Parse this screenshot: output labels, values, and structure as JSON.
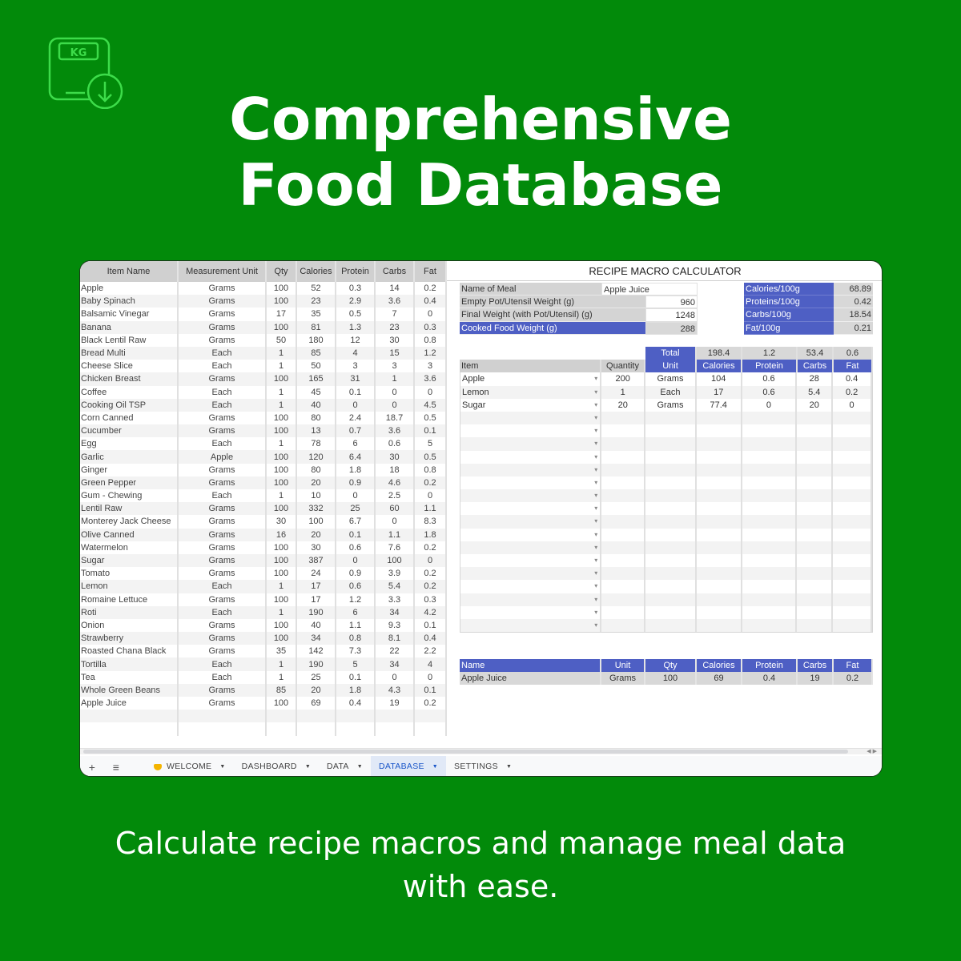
{
  "headline": {
    "line1": "Comprehensive",
    "line2": "Food Database"
  },
  "subline": {
    "line1": "Calculate recipe macros and manage meal data",
    "line2": "with ease."
  },
  "logo": {
    "icon": "weight-scale-download-icon",
    "label": "KG",
    "color": "#3ddc4a"
  },
  "colors": {
    "background": "#028a0a",
    "accent_blue": "#4e5fc4",
    "header_grey": "#d0d0d0"
  },
  "database": {
    "columns": [
      "Item Name",
      "Measurement Unit",
      "Qty",
      "Calories",
      "Protein",
      "Carbs",
      "Fat"
    ],
    "rows": [
      [
        "Apple",
        "Grams",
        "100",
        "52",
        "0.3",
        "14",
        "0.2"
      ],
      [
        "Baby Spinach",
        "Grams",
        "100",
        "23",
        "2.9",
        "3.6",
        "0.4"
      ],
      [
        "Balsamic Vinegar",
        "Grams",
        "17",
        "35",
        "0.5",
        "7",
        "0"
      ],
      [
        "Banana",
        "Grams",
        "100",
        "81",
        "1.3",
        "23",
        "0.3"
      ],
      [
        "Black Lentil Raw",
        "Grams",
        "50",
        "180",
        "12",
        "30",
        "0.8"
      ],
      [
        "Bread Multi",
        "Each",
        "1",
        "85",
        "4",
        "15",
        "1.2"
      ],
      [
        "Cheese Slice",
        "Each",
        "1",
        "50",
        "3",
        "3",
        "3"
      ],
      [
        "Chicken Breast",
        "Grams",
        "100",
        "165",
        "31",
        "1",
        "3.6"
      ],
      [
        "Coffee",
        "Each",
        "1",
        "45",
        "0.1",
        "0",
        "0"
      ],
      [
        "Cooking Oil TSP",
        "Each",
        "1",
        "40",
        "0",
        "0",
        "4.5"
      ],
      [
        "Corn Canned",
        "Grams",
        "100",
        "80",
        "2.4",
        "18.7",
        "0.5"
      ],
      [
        "Cucumber",
        "Grams",
        "100",
        "13",
        "0.7",
        "3.6",
        "0.1"
      ],
      [
        "Egg",
        "Each",
        "1",
        "78",
        "6",
        "0.6",
        "5"
      ],
      [
        "Garlic",
        "Apple",
        "100",
        "120",
        "6.4",
        "30",
        "0.5"
      ],
      [
        "Ginger",
        "Grams",
        "100",
        "80",
        "1.8",
        "18",
        "0.8"
      ],
      [
        "Green Pepper",
        "Grams",
        "100",
        "20",
        "0.9",
        "4.6",
        "0.2"
      ],
      [
        "Gum - Chewing",
        "Each",
        "1",
        "10",
        "0",
        "2.5",
        "0"
      ],
      [
        "Lentil Raw",
        "Grams",
        "100",
        "332",
        "25",
        "60",
        "1.1"
      ],
      [
        "Monterey Jack Cheese",
        "Grams",
        "30",
        "100",
        "6.7",
        "0",
        "8.3"
      ],
      [
        "Olive Canned",
        "Grams",
        "16",
        "20",
        "0.1",
        "1.1",
        "1.8"
      ],
      [
        "Watermelon",
        "Grams",
        "100",
        "30",
        "0.6",
        "7.6",
        "0.2"
      ],
      [
        "Sugar",
        "Grams",
        "100",
        "387",
        "0",
        "100",
        "0"
      ],
      [
        "Tomato",
        "Grams",
        "100",
        "24",
        "0.9",
        "3.9",
        "0.2"
      ],
      [
        "Lemon",
        "Each",
        "1",
        "17",
        "0.6",
        "5.4",
        "0.2"
      ],
      [
        "Romaine Lettuce",
        "Grams",
        "100",
        "17",
        "1.2",
        "3.3",
        "0.3"
      ],
      [
        "Roti",
        "Each",
        "1",
        "190",
        "6",
        "34",
        "4.2"
      ],
      [
        "Onion",
        "Grams",
        "100",
        "40",
        "1.1",
        "9.3",
        "0.1"
      ],
      [
        "Strawberry",
        "Grams",
        "100",
        "34",
        "0.8",
        "8.1",
        "0.4"
      ],
      [
        "Roasted Chana Black",
        "Grams",
        "35",
        "142",
        "7.3",
        "22",
        "2.2"
      ],
      [
        "Tortilla",
        "Each",
        "1",
        "190",
        "5",
        "34",
        "4"
      ],
      [
        "Tea",
        "Each",
        "1",
        "25",
        "0.1",
        "0",
        "0"
      ],
      [
        "Whole Green Beans",
        "Grams",
        "85",
        "20",
        "1.8",
        "4.3",
        "0.1"
      ],
      [
        "Apple Juice",
        "Grams",
        "100",
        "69",
        "0.4",
        "19",
        "0.2"
      ],
      [
        "",
        "",
        "",
        "",
        "",
        "",
        ""
      ],
      [
        "",
        "",
        "",
        "",
        "",
        "",
        ""
      ]
    ]
  },
  "calculator": {
    "title": "RECIPE MACRO CALCULATOR",
    "meal_name_label": "Name of Meal",
    "meal_name_value": "Apple Juice",
    "empty_pot_label": "Empty Pot/Utensil Weight (g)",
    "empty_pot_value": "960",
    "final_weight_label": "Final Weight (with Pot/Utensil) (g)",
    "final_weight_value": "1248",
    "cooked_label": "Cooked Food Weight (g)",
    "cooked_value": "288",
    "per100": [
      {
        "label": "Calories/100g",
        "value": "68.89"
      },
      {
        "label": "Proteins/100g",
        "value": "0.42"
      },
      {
        "label": "Carbs/100g",
        "value": "18.54"
      },
      {
        "label": "Fat/100g",
        "value": "0.21"
      }
    ],
    "totals": {
      "label": "Total",
      "calories": "198.4",
      "protein": "1.2",
      "carbs": "53.4",
      "fat": "0.6"
    },
    "ingredient_headers": [
      "Item",
      "Quantity",
      "Unit",
      "Calories",
      "Protein",
      "Carbs",
      "Fat"
    ],
    "ingredients": [
      [
        "Apple",
        "200",
        "Grams",
        "104",
        "0.6",
        "28",
        "0.4"
      ],
      [
        "Lemon",
        "1",
        "Each",
        "17",
        "0.6",
        "5.4",
        "0.2"
      ],
      [
        "Sugar",
        "20",
        "Grams",
        "77.4",
        "0",
        "20",
        "0"
      ],
      [
        "",
        "",
        "",
        "",
        "",
        "",
        ""
      ],
      [
        "",
        "",
        "",
        "",
        "",
        "",
        ""
      ],
      [
        "",
        "",
        "",
        "",
        "",
        "",
        ""
      ],
      [
        "",
        "",
        "",
        "",
        "",
        "",
        ""
      ],
      [
        "",
        "",
        "",
        "",
        "",
        "",
        ""
      ],
      [
        "",
        "",
        "",
        "",
        "",
        "",
        ""
      ],
      [
        "",
        "",
        "",
        "",
        "",
        "",
        ""
      ],
      [
        "",
        "",
        "",
        "",
        "",
        "",
        ""
      ],
      [
        "",
        "",
        "",
        "",
        "",
        "",
        ""
      ],
      [
        "",
        "",
        "",
        "",
        "",
        "",
        ""
      ],
      [
        "",
        "",
        "",
        "",
        "",
        "",
        ""
      ],
      [
        "",
        "",
        "",
        "",
        "",
        "",
        ""
      ],
      [
        "",
        "",
        "",
        "",
        "",
        "",
        ""
      ],
      [
        "",
        "",
        "",
        "",
        "",
        "",
        ""
      ],
      [
        "",
        "",
        "",
        "",
        "",
        "",
        ""
      ],
      [
        "",
        "",
        "",
        "",
        "",
        "",
        ""
      ],
      [
        "",
        "",
        "",
        "",
        "",
        "",
        ""
      ]
    ],
    "summary_headers": [
      "Name",
      "Unit",
      "Qty",
      "Calories",
      "Protein",
      "Carbs",
      "Fat"
    ],
    "summary_values": [
      "Apple Juice",
      "Grams",
      "100",
      "69",
      "0.4",
      "19",
      "0.2"
    ]
  },
  "sheet_tabs": {
    "add_label": "+",
    "menu_label": "≡",
    "tabs": [
      {
        "label": "WELCOME",
        "active": false
      },
      {
        "label": "DASHBOARD",
        "active": false
      },
      {
        "label": "DATA",
        "active": false
      },
      {
        "label": "DATABASE",
        "active": true
      },
      {
        "label": "SETTINGS",
        "active": false
      }
    ]
  }
}
